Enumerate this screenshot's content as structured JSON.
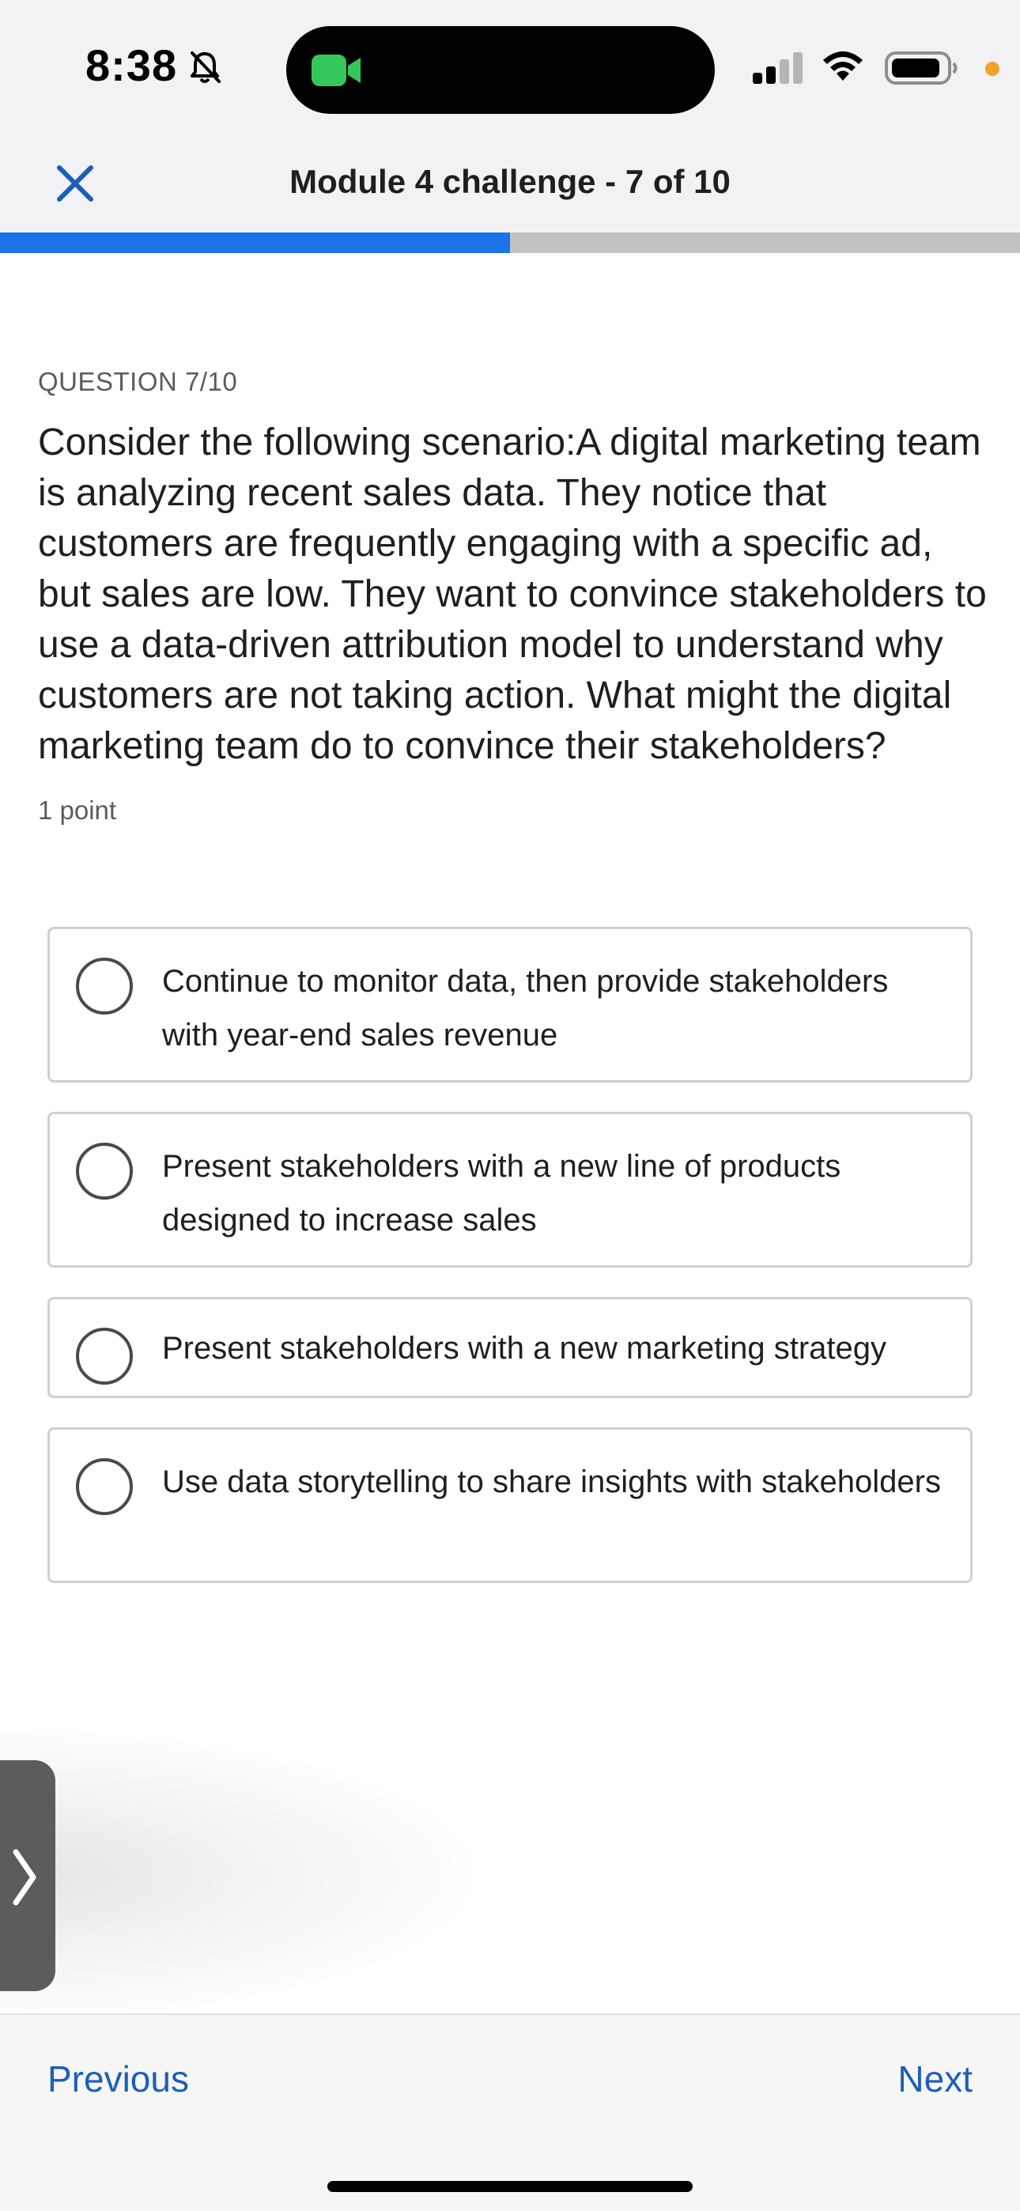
{
  "status_bar": {
    "time": "8:38",
    "icons": [
      "bell-slash-icon",
      "facetime-camera-icon",
      "cellular-signal-icon",
      "wifi-icon",
      "battery-icon"
    ],
    "accent_colors": {
      "camera": "#34c759",
      "recording_dot": "#f3a12c"
    }
  },
  "header": {
    "title": "Module 4 challenge - 7 of 10",
    "close_icon": "close-icon",
    "progress": 0.5
  },
  "question": {
    "label": "QUESTION 7/10",
    "text": "Consider the following scenario:A digital marketing team is analyzing recent sales data. They notice that customers are frequently engaging with a specific ad, but sales are low. They want to convince stakeholders to use a data-driven attribution model to understand why customers are not taking action. What might the digital marketing team do to convince their stakeholders?",
    "points": "1 point"
  },
  "options": [
    {
      "text": "Continue to monitor data, then provide stakeholders with year-end sales revenue"
    },
    {
      "text": "Present stakeholders with a new line of products designed to increase sales"
    },
    {
      "text": "Present stakeholders with a new marketing strategy"
    },
    {
      "text": "Use data storytelling to share insights with stakeholders"
    }
  ],
  "side_tab": {
    "icon": "chevron-right-icon"
  },
  "nav": {
    "previous_label": "Previous",
    "next_label": "Next"
  },
  "colors": {
    "accent": "#1a73e8",
    "link": "#1c5fb8"
  }
}
